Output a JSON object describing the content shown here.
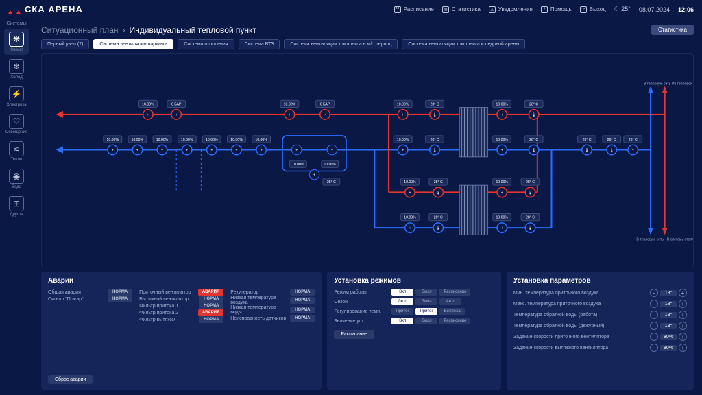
{
  "header": {
    "brand": "СКА АРЕНА",
    "nav": {
      "schedule": "Расписание",
      "stats": "Статистика",
      "notif": "Уведомления",
      "help": "Помощь",
      "exit": "Выход"
    },
    "weather": "25°",
    "date": "08.07.2024",
    "time": "12:06"
  },
  "sidebar": {
    "heading": "Системы",
    "items": [
      {
        "label": "Климат",
        "icon": "❋"
      },
      {
        "label": "Холод",
        "icon": "❄"
      },
      {
        "label": "Электрика",
        "icon": "⚡"
      },
      {
        "label": "Освещение",
        "icon": "♡"
      },
      {
        "label": "Тепло",
        "icon": "≋"
      },
      {
        "label": "Вода",
        "icon": "◉"
      },
      {
        "label": "Другое",
        "icon": "⊞"
      }
    ]
  },
  "breadcrumb": {
    "parent": "Ситуационный план",
    "current": "Индивидуальный тепловой пункт",
    "stats_btn": "Статистика"
  },
  "tabs": [
    "Первый узел (7)",
    "Система вентиляции паркинга",
    "Система отопления",
    "Система ВТЗ",
    "Система вентиляции комплекса в м/о период",
    "Система вентиляции комплекса и ледовой арены"
  ],
  "active_tab": 1,
  "diagram": {
    "legend": {
      "in_heat": "В тепловую сеть",
      "out_heat": "Из тепловой сети",
      "in_heat2": "В тепловую сеть",
      "in_sys": "В систему отопления"
    },
    "values": {
      "pct": "10.00%",
      "bar": "6 БАР",
      "temp": "28° C"
    }
  },
  "alarms": {
    "title": "Аварии",
    "col1": [
      {
        "l": "Общая авария",
        "s": "НОРМА"
      },
      {
        "l": "Сигнал \"Пожар\"",
        "s": "НОРМА"
      }
    ],
    "col2": [
      {
        "l": "Приточный вентилятор",
        "s": "АВАРИЯ"
      },
      {
        "l": "Вытяжной вентилятор",
        "s": "НОРМА"
      },
      {
        "l": "Фильтр притока 1",
        "s": "НОРМА"
      },
      {
        "l": "Фильтр притока 2",
        "s": "АВАРИЯ"
      },
      {
        "l": "Фильтр вытяжки",
        "s": "НОРМА"
      }
    ],
    "col3": [
      {
        "l": "Рекуператор",
        "s": "НОРМА"
      },
      {
        "l": "Низкая температура воздуха",
        "s": "НОРМА"
      },
      {
        "l": "Низкая температура воды",
        "s": "НОРМА"
      },
      {
        "l": "Неисправность датчиков",
        "s": "НОРМА"
      }
    ],
    "reset": "Сброс аварии"
  },
  "modes": {
    "title": "Установка режимов",
    "rows": [
      {
        "l": "Режим работы",
        "opts": [
          "Вкл",
          "Выкл",
          "Расписание"
        ],
        "active": 0
      },
      {
        "l": "Сезон",
        "opts": [
          "Лето",
          "Зима",
          "Авто"
        ],
        "active": 0
      },
      {
        "l": "Регулирование темп.",
        "opts": [
          "Приток",
          "Приток",
          "Вытяжка"
        ],
        "active": 1
      },
      {
        "l": "Значение уст.",
        "opts": [
          "Вкл",
          "Выкл",
          "Расписание"
        ],
        "active": 0
      }
    ],
    "schedule": "Расписание"
  },
  "params": {
    "title": "Установка параметров",
    "rows": [
      {
        "l": "Мин. температура приточного воздуха",
        "v": "18°"
      },
      {
        "l": "Макс. температура приточного воздуха",
        "v": "18°"
      },
      {
        "l": "Температура обратной воды (работа)",
        "v": "18°"
      },
      {
        "l": "Температура обратной воды (дежурный)",
        "v": "18°"
      },
      {
        "l": "Задание скорости приточного вентилятора",
        "v": "80%"
      },
      {
        "l": "Задание скорости вытяжного вентилятора",
        "v": "80%"
      }
    ]
  }
}
